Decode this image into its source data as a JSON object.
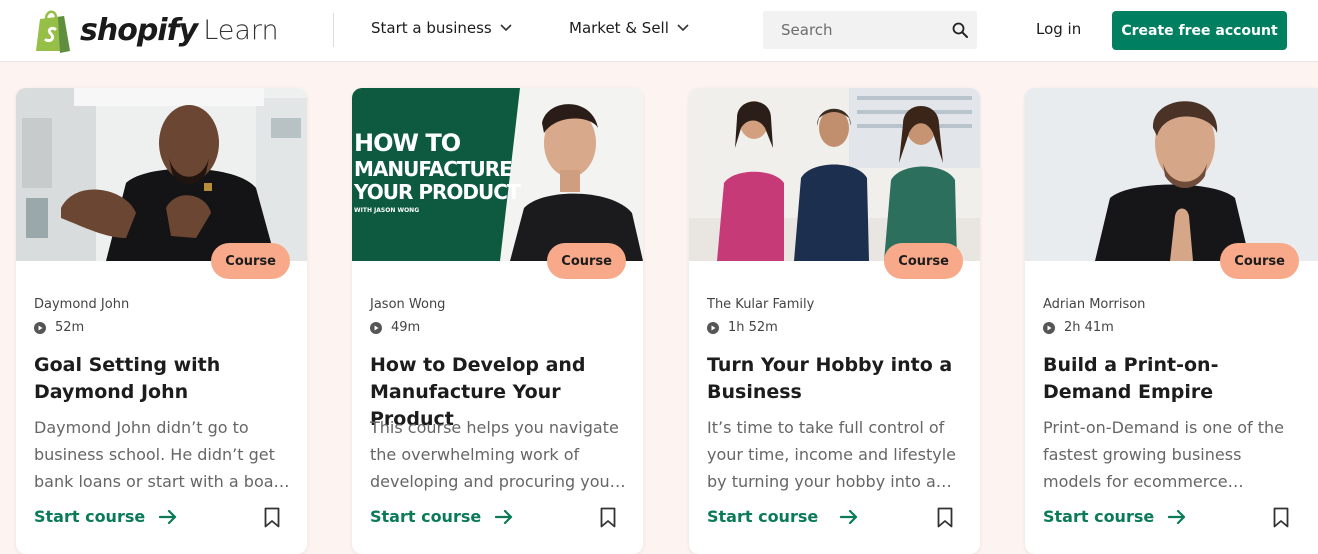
{
  "header": {
    "logo_word": "shopify",
    "logo_sub": "Learn",
    "nav": [
      {
        "label": "Start a business"
      },
      {
        "label": "Market & Sell"
      }
    ],
    "search_placeholder": "Search",
    "login_label": "Log in",
    "cta_label": "Create free account"
  },
  "colors": {
    "brand_green": "#008060",
    "link_green": "#0a7a57",
    "badge_peach": "#f7a98a",
    "page_bg": "#fdf4f1"
  },
  "cards": [
    {
      "badge": "Course",
      "author": "Daymond John",
      "duration": "52m",
      "title": "Goal Setting with Daymond John",
      "description": "Daymond John didn’t go to business school. He didn’t get bank loans or start with a board of investors.",
      "start_label": "Start course"
    },
    {
      "badge": "Course",
      "author": "Jason Wong",
      "duration": "49m",
      "title": "How to Develop and Manufacture Your Product",
      "thumb_headline": [
        "HOW TO",
        "MANUFACTURE",
        "YOUR PRODUCT"
      ],
      "thumb_byline": "WITH JASON WONG",
      "description": "This course helps you navigate the overwhelming work of developing and procuring your product.",
      "start_label": "Start course"
    },
    {
      "badge": "Course",
      "author": "The Kular Family",
      "duration": "1h 52m",
      "title": "Turn Your Hobby into a Business",
      "description": "It’s time to take full control of your time, income and lifestyle by turning your hobby into a business.",
      "start_label": "Start course"
    },
    {
      "badge": "Course",
      "author": "Adrian Morrison",
      "duration": "2h 41m",
      "title": "Build a Print-on-Demand Empire",
      "description": "Print-on-Demand is one of the fastest growing business models for ecommerce entrepreneurs.",
      "start_label": "Start course"
    }
  ]
}
